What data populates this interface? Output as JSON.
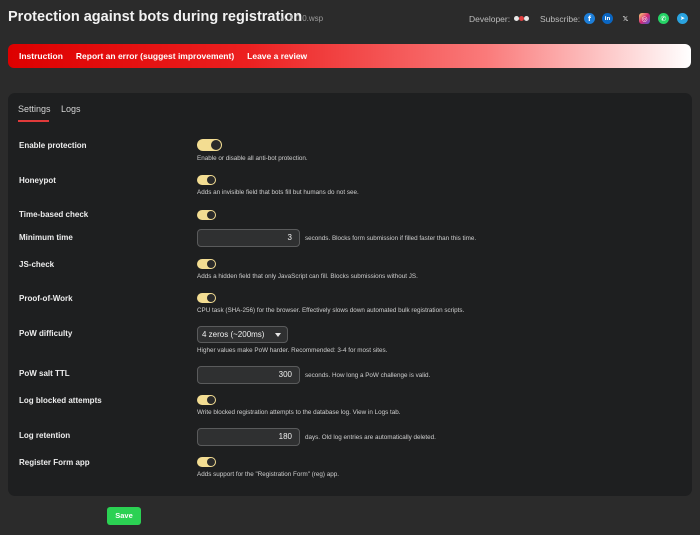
{
  "header": {
    "title": "Protection against bots during registration",
    "version": "v. 1.0.0.wsp",
    "developer_label": "Developer:",
    "subscribe_label": "Subscribe:",
    "socials": [
      {
        "name": "facebook",
        "glyph": "f",
        "color": "#1d7ed8"
      },
      {
        "name": "linkedin",
        "glyph": "in",
        "color": "#0a66c2"
      },
      {
        "name": "x",
        "glyph": "𝕏",
        "color": "#2b2b2b"
      },
      {
        "name": "instagram",
        "glyph": "◎",
        "color": "#d62976"
      },
      {
        "name": "whatsapp",
        "glyph": "✆",
        "color": "#25d366"
      },
      {
        "name": "telegram",
        "glyph": "➤",
        "color": "#2aa3e0"
      }
    ]
  },
  "nav": {
    "instruction": "Instruction",
    "report": "Report an error (suggest improvement)",
    "review": "Leave a review"
  },
  "tabs": {
    "settings": "Settings",
    "logs": "Logs"
  },
  "settings": {
    "enable_protection": {
      "label": "Enable protection",
      "checked": true,
      "desc": "Enable or disable all anti-bot protection."
    },
    "honeypot": {
      "label": "Honeypot",
      "checked": true,
      "desc": "Adds an invisible field that bots fill but humans do not see."
    },
    "time_check": {
      "label": "Time-based check",
      "checked": true
    },
    "minimum_time": {
      "label": "Minimum time",
      "value": "3",
      "desc": "seconds. Blocks form submission if filled faster than this time."
    },
    "js_check": {
      "label": "JS-check",
      "checked": true,
      "desc": "Adds a hidden field that only JavaScript can fill. Blocks submissions without JS."
    },
    "pow": {
      "label": "Proof-of-Work",
      "checked": true,
      "desc": "CPU task (SHA-256) for the browser. Effectively slows down automated bulk registration scripts."
    },
    "pow_difficulty": {
      "label": "PoW difficulty",
      "value": "4 zeros (~200ms)",
      "desc": "Higher values make PoW harder. Recommended: 3-4 for most sites."
    },
    "pow_ttl": {
      "label": "PoW salt TTL",
      "value": "300",
      "desc": "seconds. How long a PoW challenge is valid."
    },
    "log_blocked": {
      "label": "Log blocked attempts",
      "checked": true,
      "desc": "Write blocked registration attempts to the database log. View in Logs tab."
    },
    "log_retention": {
      "label": "Log retention",
      "value": "180",
      "desc": "days. Old log entries are automatically deleted."
    },
    "register_form": {
      "label": "Register Form app",
      "checked": true,
      "desc": "Adds support for the \"Registration Form\" (reg) app."
    }
  },
  "save_label": "Save",
  "colors": {
    "accent_red": "#e03a3a",
    "toggle_on": "#f3dd92",
    "save_green": "#2bd153"
  }
}
